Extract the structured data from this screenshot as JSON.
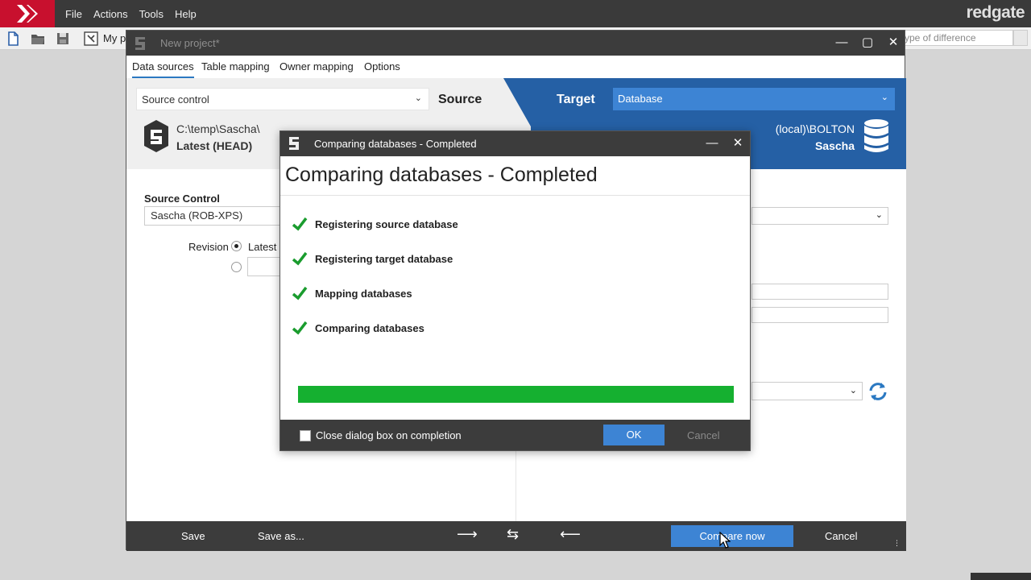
{
  "app": {
    "menu": [
      "File",
      "Actions",
      "Tools",
      "Help"
    ],
    "brand": "redgate",
    "project_label": "My p",
    "filter_placeholder": "ype of difference"
  },
  "window": {
    "title": "New project*",
    "tabs": [
      "Data sources",
      "Table mapping",
      "Owner mapping",
      "Options"
    ],
    "source": {
      "type": "Source control",
      "label": "Source",
      "path": "C:\\temp\\Sascha\\",
      "revision": "Latest (HEAD)"
    },
    "target": {
      "label": "Target",
      "type": "Database",
      "server": "(local)\\BOLTON",
      "database": "Sascha"
    },
    "form": {
      "source_control_label": "Source Control",
      "source_control_value": "Sascha (ROB-XPS)",
      "revision_label": "Revision",
      "latest_option": "Latest ("
    },
    "footer": {
      "save": "Save",
      "save_as": "Save as...",
      "compare": "Compare now",
      "cancel": "Cancel"
    }
  },
  "dialog": {
    "title": "Comparing databases - Completed",
    "heading": "Comparing databases - Completed",
    "steps": [
      {
        "label": "Registering source database",
        "done": true
      },
      {
        "label": "Registering target database",
        "done": true
      },
      {
        "label": "Mapping databases",
        "done": true
      },
      {
        "label": "Comparing databases",
        "done": true
      }
    ],
    "progress": 1.0,
    "close_on_completion_label": "Close dialog box on completion",
    "close_on_completion_checked": false,
    "ok": "OK",
    "cancel": "Cancel"
  },
  "colors": {
    "accent_blue": "#3d84d4",
    "target_blue": "#2560a5",
    "progress_green": "#15b030",
    "check_green": "#1a9c2e",
    "titlebar_dark": "#3c3c3c",
    "brand_red": "#c8102e"
  },
  "icons": [
    "redgate-logo-icon",
    "new-file-icon",
    "open-folder-icon",
    "save-icon",
    "project-icon",
    "source-control-icon",
    "database-icon",
    "refresh-icon",
    "check-icon",
    "arrow-right-icon",
    "swap-icon",
    "arrow-left-icon",
    "minimize-icon",
    "maximize-icon",
    "close-icon",
    "chevron-down-icon"
  ]
}
